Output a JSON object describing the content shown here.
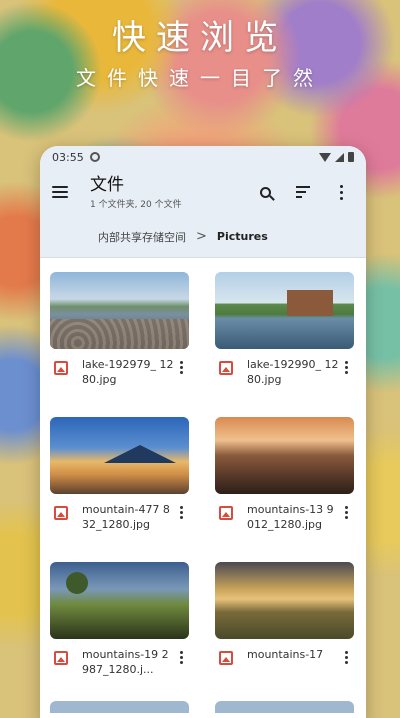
{
  "hero": {
    "title": "快速浏览",
    "subtitle": "文件快速一目了然"
  },
  "status_bar": {
    "time": "03:55"
  },
  "appbar": {
    "title": "文件",
    "subtitle": "1 个文件夹, 20 个文件",
    "icons": [
      "menu-icon",
      "search-icon",
      "sort-icon",
      "more-vert-icon"
    ]
  },
  "breadcrumb": {
    "root": "内部共享存储空间",
    "separator": ">",
    "current": "Pictures"
  },
  "files": [
    {
      "name": "lake-192979_ 1280.jpg"
    },
    {
      "name": "lake-192990_ 1280.jpg"
    },
    {
      "name": "mountain-477 832_1280.jpg"
    },
    {
      "name": "mountains-13 9012_1280.jpg"
    },
    {
      "name": "mountains-19 2987_1280.j..."
    },
    {
      "name": "mountains-17"
    }
  ],
  "colors": {
    "appbar_bg": "#e8eef5",
    "file_icon": "#d94c3d"
  }
}
